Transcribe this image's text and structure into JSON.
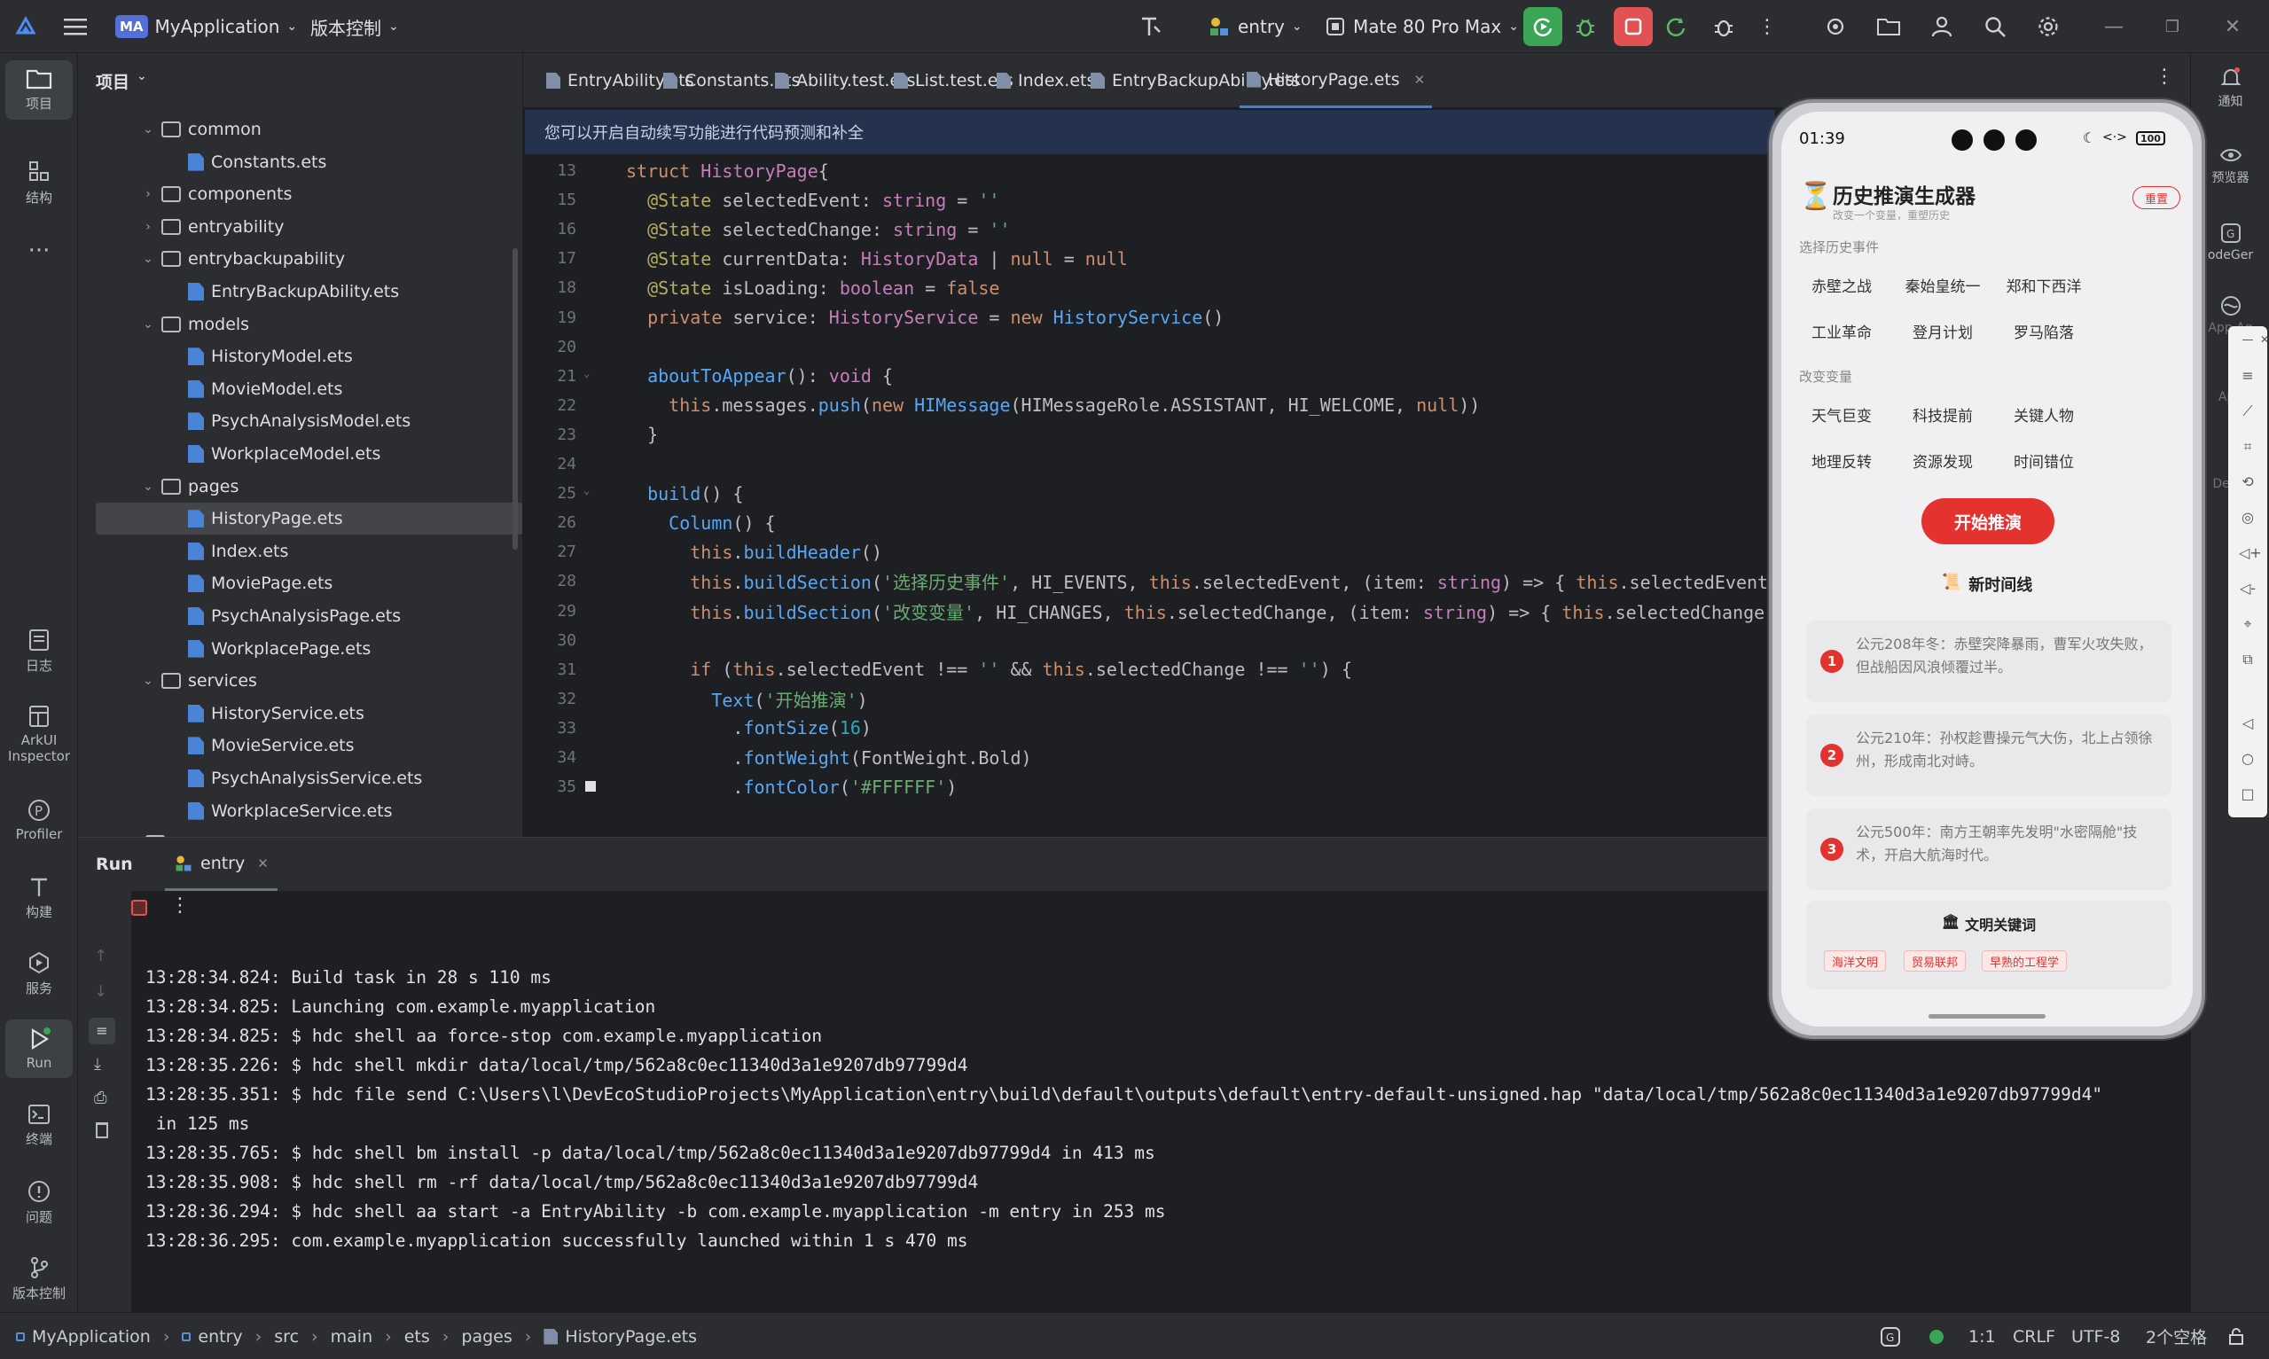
{
  "titlebar": {
    "project_badge": "MA",
    "project_name": "MyApplication",
    "vcs_label": "版本控制",
    "run_config": "entry",
    "device": "Mate 80 Pro Max"
  },
  "left_rail": {
    "items": [
      {
        "label": "项目"
      },
      {
        "label": "结构"
      },
      {
        "label": "日志"
      },
      {
        "label": "ArkUI Inspector"
      },
      {
        "label": "Profiler"
      },
      {
        "label": "构建"
      },
      {
        "label": "服务"
      },
      {
        "label": "Run"
      },
      {
        "label": "终端"
      },
      {
        "label": "问题"
      },
      {
        "label": "版本控制"
      }
    ]
  },
  "project_panel": {
    "title": "项目",
    "tree": [
      {
        "label": "common",
        "type": "folder",
        "expanded": true
      },
      {
        "label": "Constants.ets",
        "type": "file"
      },
      {
        "label": "components",
        "type": "folder",
        "expanded": false
      },
      {
        "label": "entryability",
        "type": "folder",
        "expanded": false
      },
      {
        "label": "entrybackupability",
        "type": "folder",
        "expanded": true
      },
      {
        "label": "EntryBackupAbility.ets",
        "type": "file"
      },
      {
        "label": "models",
        "type": "folder",
        "expanded": true
      },
      {
        "label": "HistoryModel.ets",
        "type": "file"
      },
      {
        "label": "MovieModel.ets",
        "type": "file"
      },
      {
        "label": "PsychAnalysisModel.ets",
        "type": "file"
      },
      {
        "label": "WorkplaceModel.ets",
        "type": "file"
      },
      {
        "label": "pages",
        "type": "folder",
        "expanded": true
      },
      {
        "label": "HistoryPage.ets",
        "type": "file",
        "selected": true
      },
      {
        "label": "Index.ets",
        "type": "file"
      },
      {
        "label": "MoviePage.ets",
        "type": "file"
      },
      {
        "label": "PsychAnalysisPage.ets",
        "type": "file"
      },
      {
        "label": "WorkplacePage.ets",
        "type": "file"
      },
      {
        "label": "services",
        "type": "folder",
        "expanded": true
      },
      {
        "label": "HistoryService.ets",
        "type": "file"
      },
      {
        "label": "MovieService.ets",
        "type": "file"
      },
      {
        "label": "PsychAnalysisService.ets",
        "type": "file"
      },
      {
        "label": "WorkplaceService.ets",
        "type": "file"
      },
      {
        "label": "resources",
        "type": "folder",
        "expanded": false
      }
    ]
  },
  "editor_tabs": [
    {
      "label": "EntryAbility.ets"
    },
    {
      "label": "Constants.ets"
    },
    {
      "label": "Ability.test.ets"
    },
    {
      "label": "List.test.ets"
    },
    {
      "label": "Index.ets"
    },
    {
      "label": "EntryBackupAbility.ets"
    },
    {
      "label": "HistoryPage.ets",
      "active": true
    }
  ],
  "notice": "您可以开启自动续写功能进行代码预测和补全",
  "code_lines": [
    {
      "n": "13",
      "segs": [
        [
          "kw",
          "struct "
        ],
        [
          "ty",
          "HistoryPage"
        ],
        [
          "",
          "{"
        ]
      ]
    },
    {
      "n": "15",
      "segs": [
        [
          "an",
          "  @State "
        ],
        [
          "",
          "selectedEvent: "
        ],
        [
          "ty",
          "string"
        ],
        [
          "",
          " = "
        ],
        [
          "st",
          "''"
        ]
      ]
    },
    {
      "n": "16",
      "segs": [
        [
          "an",
          "  @State "
        ],
        [
          "",
          "selectedChange: "
        ],
        [
          "ty",
          "string"
        ],
        [
          "",
          " = "
        ],
        [
          "st",
          "''"
        ]
      ]
    },
    {
      "n": "17",
      "segs": [
        [
          "an",
          "  @State "
        ],
        [
          "",
          "currentData: "
        ],
        [
          "ty",
          "HistoryData"
        ],
        [
          "",
          " | "
        ],
        [
          "kw",
          "null"
        ],
        [
          "",
          " = "
        ],
        [
          "kw",
          "null"
        ]
      ]
    },
    {
      "n": "18",
      "segs": [
        [
          "an",
          "  @State "
        ],
        [
          "",
          "isLoading: "
        ],
        [
          "ty",
          "boolean"
        ],
        [
          "",
          " = "
        ],
        [
          "kw",
          "false"
        ]
      ]
    },
    {
      "n": "19",
      "segs": [
        [
          "kw",
          "  private "
        ],
        [
          "",
          "service: "
        ],
        [
          "ty",
          "HistoryService"
        ],
        [
          "",
          " = "
        ],
        [
          "kw",
          "new "
        ],
        [
          "fn",
          "HistoryService"
        ],
        [
          "",
          "()"
        ]
      ]
    },
    {
      "n": "20",
      "segs": [
        [
          "",
          ""
        ]
      ]
    },
    {
      "n": "21",
      "segs": [
        [
          "fn",
          "  aboutToAppear"
        ],
        [
          "",
          "(): "
        ],
        [
          "ty",
          "void"
        ],
        [
          "",
          " {"
        ]
      ]
    },
    {
      "n": "22",
      "segs": [
        [
          "kw",
          "    this"
        ],
        [
          ".messages."
        ],
        [
          "fn",
          "push"
        ],
        [
          "",
          "("
        ],
        [
          "kw",
          "new "
        ],
        [
          "fn",
          "HIMessage"
        ],
        [
          "",
          "(HIMessageRole.ASSISTANT, HI_WELCOME, "
        ],
        [
          "kw",
          "null"
        ],
        [
          "",
          "))"
        ]
      ]
    },
    {
      "n": "23",
      "segs": [
        [
          "",
          "  }"
        ]
      ]
    },
    {
      "n": "24",
      "segs": [
        [
          "",
          ""
        ]
      ]
    },
    {
      "n": "25",
      "segs": [
        [
          "fn",
          "  build"
        ],
        [
          "",
          "() {"
        ]
      ]
    },
    {
      "n": "26",
      "segs": [
        [
          "fn",
          "    Column"
        ],
        [
          "",
          "() {"
        ]
      ]
    },
    {
      "n": "27",
      "segs": [
        [
          "kw",
          "      this"
        ],
        [
          "",
          "."
        ],
        [
          "fn",
          "buildHeader"
        ],
        [
          "",
          "()"
        ]
      ]
    },
    {
      "n": "28",
      "segs": [
        [
          "kw",
          "      this"
        ],
        [
          "",
          "."
        ],
        [
          "fn",
          "buildSection"
        ],
        [
          "",
          "("
        ],
        [
          "st",
          "'选择历史事件'"
        ],
        [
          "",
          ", HI_EVENTS, "
        ],
        [
          "kw",
          "this"
        ],
        [
          "",
          ".selectedEvent, (item: "
        ],
        [
          "ty",
          "string"
        ],
        [
          "",
          ") => { "
        ],
        [
          "kw",
          "this"
        ],
        [
          "",
          ".selectedEvent"
        ]
      ]
    },
    {
      "n": "29",
      "segs": [
        [
          "kw",
          "      this"
        ],
        [
          "",
          "."
        ],
        [
          "fn",
          "buildSection"
        ],
        [
          "",
          "("
        ],
        [
          "st",
          "'改变变量'"
        ],
        [
          "",
          ", HI_CHANGES, "
        ],
        [
          "kw",
          "this"
        ],
        [
          "",
          ".selectedChange, (item: "
        ],
        [
          "ty",
          "string"
        ],
        [
          "",
          ") => { "
        ],
        [
          "kw",
          "this"
        ],
        [
          "",
          ".selectedChange"
        ]
      ]
    },
    {
      "n": "30",
      "segs": [
        [
          "",
          ""
        ]
      ]
    },
    {
      "n": "31",
      "segs": [
        [
          "kw",
          "      if "
        ],
        [
          "",
          "("
        ],
        [
          "kw",
          "this"
        ],
        [
          "",
          ".selectedEvent !== "
        ],
        [
          "st",
          "''"
        ],
        [
          "",
          " && "
        ],
        [
          "kw",
          "this"
        ],
        [
          "",
          ".selectedChange !== "
        ],
        [
          "st",
          "''"
        ],
        [
          "",
          ") {"
        ]
      ]
    },
    {
      "n": "32",
      "segs": [
        [
          "fn",
          "        Text"
        ],
        [
          "",
          "("
        ],
        [
          "st",
          "'开始推演'"
        ],
        [
          "",
          ")"
        ]
      ]
    },
    {
      "n": "33",
      "segs": [
        [
          "",
          "          ."
        ],
        [
          "fn",
          "fontSize"
        ],
        [
          "",
          "("
        ],
        [
          "nu",
          "16"
        ],
        [
          "",
          ")"
        ]
      ]
    },
    {
      "n": "34",
      "segs": [
        [
          "",
          "          ."
        ],
        [
          "fn",
          "fontWeight"
        ],
        [
          "",
          "(FontWeight.Bold)"
        ]
      ]
    },
    {
      "n": "35",
      "segs": [
        [
          "",
          "          ."
        ],
        [
          "fn",
          "fontColor"
        ],
        [
          "",
          "("
        ],
        [
          "st",
          "'#FFFFFF'"
        ],
        [
          "",
          ")"
        ]
      ]
    }
  ],
  "run_panel": {
    "title": "Run",
    "tab": "entry",
    "log": [
      "13:28:34.824: Build task in 28 s 110 ms",
      "13:28:34.825: Launching com.example.myapplication",
      "13:28:34.825: $ hdc shell aa force-stop com.example.myapplication",
      "13:28:35.226: $ hdc shell mkdir data/local/tmp/562a8c0ec11340d3a1e9207db97799d4",
      "13:28:35.351: $ hdc file send C:\\Users\\l\\DevEcoStudioProjects\\MyApplication\\entry\\build\\default\\outputs\\default\\entry-default-unsigned.hap \"data/local/tmp/562a8c0ec11340d3a1e9207db97799d4\"",
      " in 125 ms",
      "13:28:35.765: $ hdc shell bm install -p data/local/tmp/562a8c0ec11340d3a1e9207db97799d4 in 413 ms",
      "13:28:35.908: $ hdc shell rm -rf data/local/tmp/562a8c0ec11340d3a1e9207db97799d4",
      "13:28:36.294: $ hdc shell aa start -a EntryAbility -b com.example.myapplication -m entry in 253 ms",
      "13:28:36.295: com.example.myapplication successfully launched within 1 s 470 ms"
    ]
  },
  "right_rail": {
    "items": [
      {
        "label": "通知"
      },
      {
        "label": "预览器"
      },
      {
        "label": "odeGer"
      },
      {
        "label": "App Ag"
      },
      {
        "label": "App"
      },
      {
        "label": "De ile"
      }
    ]
  },
  "status_bar": {
    "breadcrumb": [
      "MyApplication",
      "entry",
      "src",
      "main",
      "ets",
      "pages",
      "HistoryPage.ets"
    ],
    "position": "1:1",
    "line_sep": "CRLF",
    "encoding": "UTF-8",
    "indent": "2个空格"
  },
  "phone": {
    "time": "01:39",
    "battery": "100",
    "app_title": "历史推演生成器",
    "app_subtitle": "改变一个变量，重塑历史",
    "reset": "重置",
    "events_label": "选择历史事件",
    "events": [
      "赤壁之战",
      "秦始皇统一",
      "郑和下西洋",
      "工业革命",
      "登月计划",
      "罗马陷落"
    ],
    "changes_label": "改变变量",
    "changes": [
      "天气巨变",
      "科技提前",
      "关键人物",
      "地理反转",
      "资源发现",
      "时间错位"
    ],
    "start_button": "开始推演",
    "timeline_title": "新时间线",
    "timeline": [
      {
        "num": "1",
        "text": "公元208年冬：赤壁突降暴雨，曹军火攻失败，但战船因风浪倾覆过半。"
      },
      {
        "num": "2",
        "text": "公元210年：孙权趁曹操元气大伤，北上占领徐州，形成南北对峙。"
      },
      {
        "num": "3",
        "text": "公元500年：南方王朝率先发明\"水密隔舱\"技术，开启大航海时代。"
      }
    ],
    "keywords_title": "文明关键词",
    "keywords": [
      "海洋文明",
      "贸易联邦",
      "早熟的工程学"
    ]
  },
  "colors": {
    "accent": "#3f7fe0",
    "phone_accent": "#e4322f",
    "run_green": "#3aa655",
    "stop_red": "#e35252"
  }
}
